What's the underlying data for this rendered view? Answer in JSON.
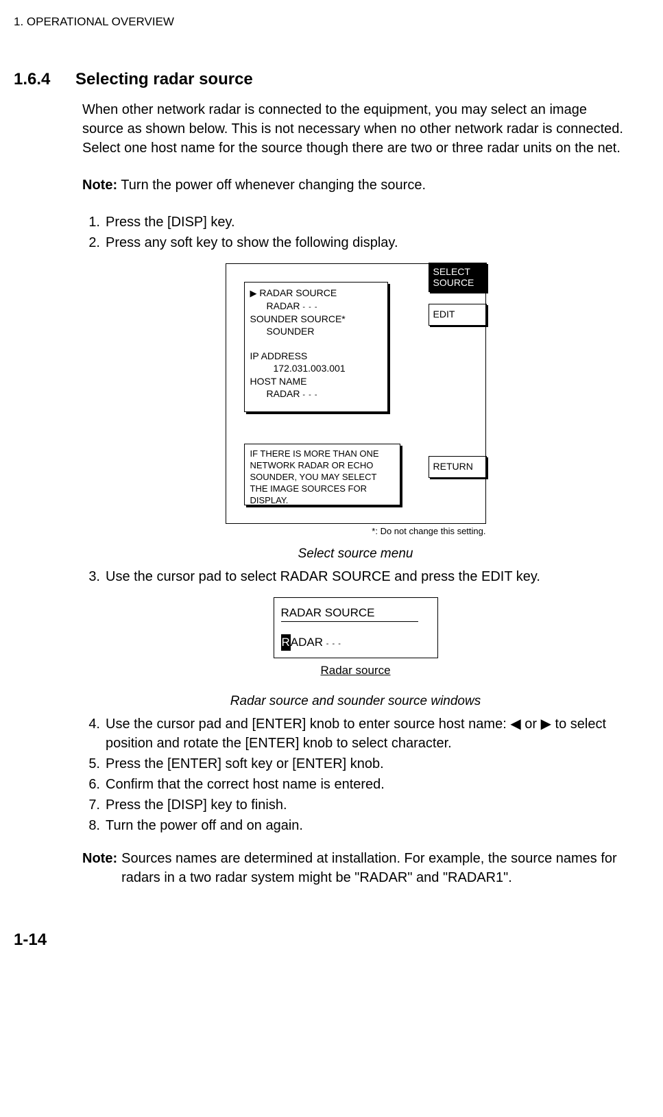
{
  "page_header": "1. OPERATIONAL OVERVIEW",
  "section": {
    "num": "1.6.4",
    "title": "Selecting radar source"
  },
  "intro": "When other network radar is connected to the equipment, you may select an image source as shown below. This is not necessary when no other network radar is connected. Select one host name for the source though there are two or three radar units on the net.",
  "note1": {
    "label": "Note:",
    "text": " Turn the power off whenever changing the source."
  },
  "steps_a": [
    {
      "n": "1.",
      "t": "Press the [DISP] key."
    },
    {
      "n": "2.",
      "t": "Press any soft key to show the following display."
    }
  ],
  "menu": {
    "radar_source_label": "RADAR  SOURCE",
    "radar_value": "RADAR",
    "sounder_source_label": "SOUNDER SOURCE*",
    "sounder_value": "SOUNDER",
    "ip_label": "IP ADDRESS",
    "ip_value": "172.031.003.001",
    "host_label": "HOST NAME",
    "host_value": "RADAR",
    "dashes": "- - -"
  },
  "softkeys": {
    "select_source_l1": "SELECT",
    "select_source_l2": "SOURCE",
    "edit": "EDIT",
    "ret": "RETURN"
  },
  "msg": "IF THERE IS MORE THAN ONE NETWORK RADAR OR ECHO SOUNDER, YOU MAY SELECT THE IMAGE SOURCES FOR DISPLAY.",
  "footnote": "*: Do not change this setting.",
  "caption1": "Select source menu",
  "step3": {
    "n": "3.",
    "t": "Use the cursor pad to select RADAR SOURCE and press the EDIT key."
  },
  "radar_box": {
    "title": "RADAR SOURCE",
    "cursor": "R",
    "rest": "ADAR",
    "dashes": "- - -"
  },
  "small_caption": "Radar source",
  "caption2": "Radar source and sounder source windows",
  "steps_b": [
    {
      "n": "4.",
      "pre": "Use the cursor pad and [ENTER] knob to enter source host name: ",
      "arrowL": "◀",
      "mid": " or ",
      "arrowR": "▶",
      "post": " to select position and rotate the [ENTER] knob to select character."
    },
    {
      "n": "5.",
      "t": "Press the [ENTER] soft key or [ENTER] knob."
    },
    {
      "n": "6.",
      "t": "Confirm that the correct host name is entered."
    },
    {
      "n": "7.",
      "t": "Press the [DISP] key to finish."
    },
    {
      "n": "8.",
      "t": "Turn the power off and on again."
    }
  ],
  "note2": {
    "label": "Note:",
    "text": " Sources names are determined at installation. For example, the source names for radars in a two radar system might be \"RADAR\" and \"RADAR1\"."
  },
  "page_footer": "1-14"
}
